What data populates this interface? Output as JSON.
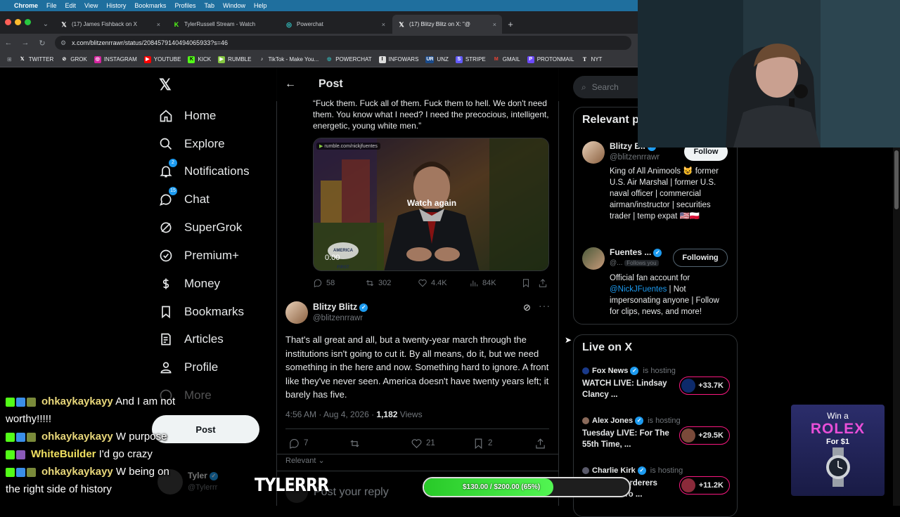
{
  "menubar": {
    "apple": "",
    "items": [
      "Chrome",
      "File",
      "Edit",
      "View",
      "History",
      "Bookmarks",
      "Profiles",
      "Tab",
      "Window",
      "Help"
    ]
  },
  "tabs": [
    {
      "label": "(17) James Fishback on X",
      "icon": "x-logo-icon"
    },
    {
      "label": "TylerRussell Stream - Watch",
      "icon": "kick-logo-icon"
    },
    {
      "label": "Powerchat",
      "icon": "powerchat-logo-icon"
    },
    {
      "label": "(17) Blitzy Blitz on X: \"@",
      "icon": "x-logo-icon",
      "active": true
    }
  ],
  "url": "x.com/blitzenrrawr/status/2084579140494065933?s=46",
  "bookmarks": [
    "TWITTER",
    "GROK",
    "INSTAGRAM",
    "YOUTUBE",
    "KICK",
    "RUMBLE",
    "TikTok - Make You...",
    "POWERCHAT",
    "INFOWARS",
    "UNZ",
    "STRIPE",
    "GMAIL",
    "PROTONMAIL",
    "NYT"
  ],
  "sidebar": {
    "items": [
      {
        "label": "Home",
        "icon": "home-icon"
      },
      {
        "label": "Explore",
        "icon": "search-icon"
      },
      {
        "label": "Notifications",
        "icon": "bell-icon",
        "badge": "2"
      },
      {
        "label": "Chat",
        "icon": "chat-icon",
        "badge": "15"
      },
      {
        "label": "SuperGrok",
        "icon": "grok-icon"
      },
      {
        "label": "Premium+",
        "icon": "premium-icon"
      },
      {
        "label": "Money",
        "icon": "money-icon"
      },
      {
        "label": "Bookmarks",
        "icon": "bookmark-icon"
      },
      {
        "label": "Articles",
        "icon": "articles-icon"
      },
      {
        "label": "Profile",
        "icon": "profile-icon"
      },
      {
        "label": "More",
        "icon": "more-icon"
      }
    ],
    "post_button": "Post",
    "account_name": "Tyler",
    "account_handle": "@Tylerrr"
  },
  "header": {
    "title": "Post"
  },
  "quoted": {
    "text": "“Fuck them. Fuck all of them. Fuck them to hell. We don't need them. You know what I need? I need the precocious, intelligent, energetic, young white men.”",
    "media_source": "rumble.com/nickjfuentes",
    "watch_again": "Watch again",
    "time": "0:00",
    "sign": "AMERICA FIRST",
    "stats": {
      "replies": "58",
      "reposts": "302",
      "likes": "4.4K",
      "views": "84K"
    }
  },
  "reply": {
    "name": "Blitzy Blitz",
    "handle": "@blitzenrrawr",
    "text": "That's all great and all, but a twenty-year march through the institutions isn't going to cut it. By all means, do it, but we need something in the here and now. Something hard to ignore. A front like they've never seen. America doesn't have twenty years left; it barely has five.",
    "timestamp": "4:56 AM · Aug 4, 2026 · ",
    "views_count": "1,182",
    "views_label": " Views",
    "stats": {
      "replies": "7",
      "reposts": "",
      "likes": "21",
      "bookmarks": "2"
    },
    "relevant": "Relevant",
    "reply_placeholder": "Post your reply"
  },
  "right": {
    "search_placeholder": "Search",
    "relevant_title": "Relevant p",
    "people": [
      {
        "name": "Blitzy Bli",
        "handle": "@blitzenrrawr",
        "button": "Follow",
        "bio": "King of All Animools 😺 former U.S. Air Marshal | former U.S. naval officer | commercial airman/instructor | securities trader | temp expat 🇺🇸🇵🇱"
      },
      {
        "name": "Fuentes ...",
        "handle": "@...",
        "follows_you": "Follows you",
        "button": "Following",
        "bio_pre": "Official fan account for ",
        "bio_link": "@NickJFuentes",
        "bio_post": " | Not impersonating anyone | Follow for clips, news, and more!"
      }
    ],
    "live_title": "Live on X",
    "live": [
      {
        "host": "Fox News",
        "hosting": "is hosting",
        "title": "WATCH LIVE: Lindsay Clancy ...",
        "count": "+33.7K"
      },
      {
        "host": "Alex Jones",
        "hosting": "is hosting",
        "title": "Tuesday LIVE: For The 55th Time, ...",
        "count": "+29.5K"
      },
      {
        "host": "Charlie Kirk",
        "hosting": "is hosting",
        "title": "The DSA Murderers Row Goes To ...",
        "count": "+11.2K"
      }
    ]
  },
  "chat": [
    {
      "user": "ohkaykaykayy",
      "msg": "And I am not",
      "cont": "worthy!!!!!"
    },
    {
      "user": "ohkaykaykayy",
      "msg": "W purpose"
    },
    {
      "user": "WhiteBuilder",
      "msg": "I'd go crazy"
    },
    {
      "user": "ohkaykaykayy",
      "msg": "W being on",
      "cont": "the right side of history"
    }
  ],
  "streamer_name": "TYLERRR",
  "goal": {
    "label": "$130.00 / $200.00 (65%)",
    "fraction": 0.65
  },
  "ad": {
    "line1": "Win a",
    "line2": "ROLEX",
    "line3": "For $1"
  },
  "colors": {
    "accent": "#1d9bf0",
    "goal_green": "#3ce03c",
    "like_pink": "#f91880"
  }
}
